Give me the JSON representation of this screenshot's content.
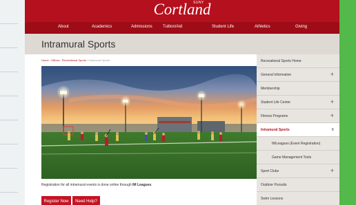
{
  "header": {
    "logo_suny": "SUNY",
    "logo_name": "Cortland"
  },
  "nav": {
    "items": [
      "About",
      "Academics",
      "Admissions",
      "Tuition/Aid",
      "Student Life",
      "Athletics",
      "Giving"
    ]
  },
  "page": {
    "title": "Intramural Sports"
  },
  "breadcrumb": {
    "items": [
      "Home",
      "Offices",
      "Recreational Sports",
      "Intramural Sports"
    ],
    "separator": "/"
  },
  "content": {
    "caption_text": "Registration for all intramural events is done online through ",
    "caption_link": "IM Leagues",
    "caption_end": ".",
    "register_button": "Register Now",
    "help_button": "Need Help?"
  },
  "sidebar": {
    "items": [
      {
        "label": "Recreational Sports Home",
        "toggle": ""
      },
      {
        "label": "General Information",
        "toggle": "+"
      },
      {
        "label": "Membership",
        "toggle": ""
      },
      {
        "label": "Student Life Center",
        "toggle": "+"
      },
      {
        "label": "Fitness Programs",
        "toggle": "+"
      },
      {
        "label": "Intramural Sports",
        "toggle": "x"
      },
      {
        "label": "IMLeagues (Event Registration)",
        "toggle": ""
      },
      {
        "label": "Game Management Tools",
        "toggle": ""
      },
      {
        "label": "Sport Clubs",
        "toggle": "+"
      },
      {
        "label": "Outdoor Pursuits",
        "toggle": ""
      },
      {
        "label": "Swim Lessons",
        "toggle": ""
      }
    ]
  },
  "colors": {
    "brand_red": "#b5101d",
    "nav_red": "#9e0d17",
    "side_bg": "#e8e4e0",
    "accent_green": "#52b94a"
  }
}
